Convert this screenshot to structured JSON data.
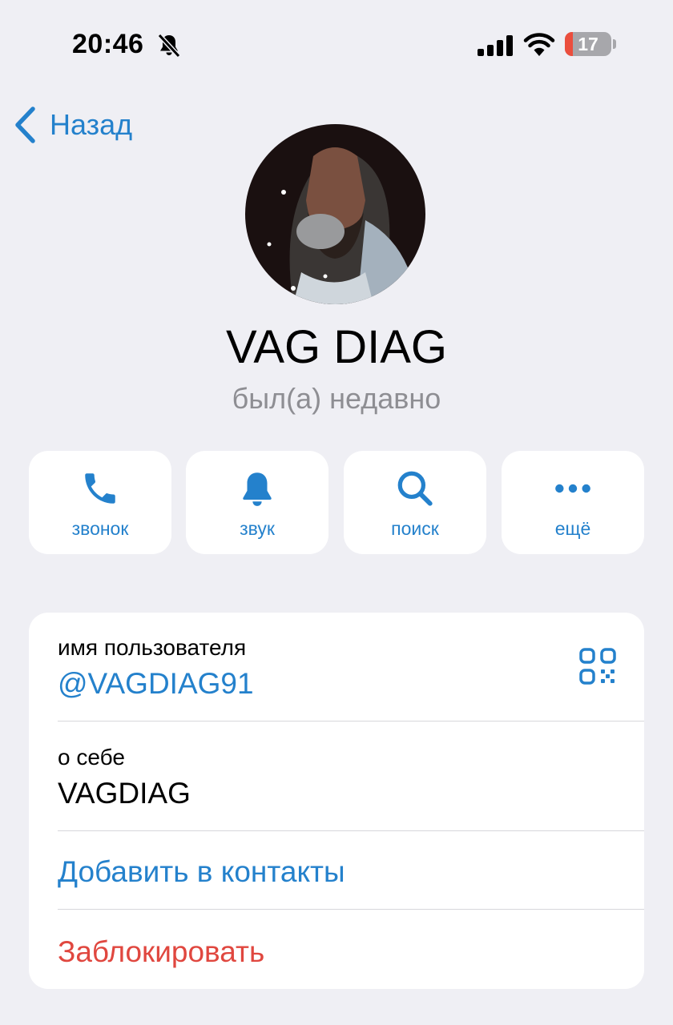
{
  "status_bar": {
    "time": "20:46",
    "silent_icon": "bell-slash-icon",
    "signal_icon": "cellular-signal-icon",
    "wifi_icon": "wifi-icon",
    "battery_level": "17",
    "battery_fraction": 0.17,
    "battery_color": "#eb4e3d"
  },
  "nav": {
    "back_label": "Назад",
    "back_icon": "chevron-left-icon"
  },
  "profile": {
    "name": "VAG DIAG",
    "last_seen": "был(а) недавно"
  },
  "actions": [
    {
      "label": "звонок",
      "icon": "phone-icon"
    },
    {
      "label": "звук",
      "icon": "bell-icon"
    },
    {
      "label": "поиск",
      "icon": "search-icon"
    },
    {
      "label": "ещё",
      "icon": "more-icon"
    }
  ],
  "info": {
    "username_label": "имя пользователя",
    "username_value": "@VAGDIAG91",
    "qr_icon": "qr-code-icon",
    "bio_label": "о себе",
    "bio_value": "VAGDIAG",
    "add_contact": "Добавить в контакты",
    "block": "Заблокировать"
  },
  "colors": {
    "accent": "#2481cc",
    "destructive": "#e0473f",
    "background": "#efeff4",
    "secondary_text": "#8e8e93"
  }
}
